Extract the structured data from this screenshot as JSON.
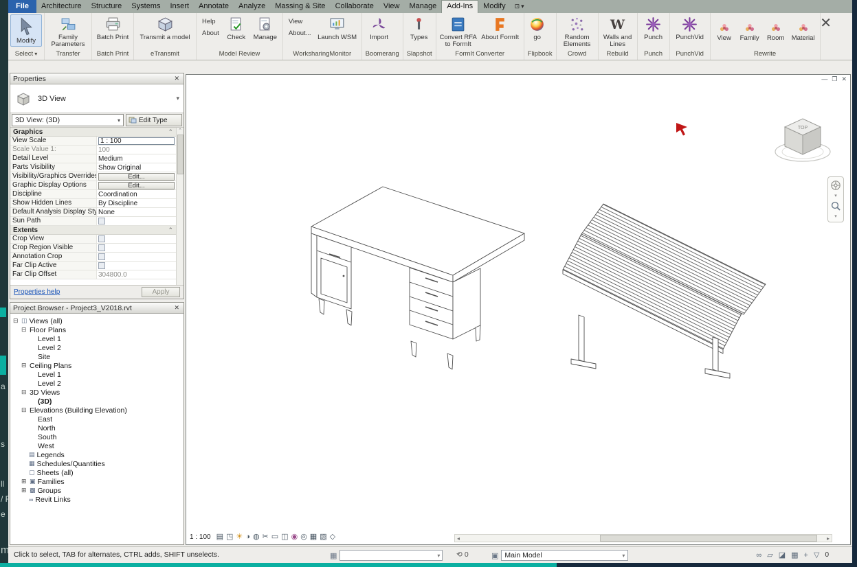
{
  "glyphs": {
    "close": "✕",
    "dropdown": "▾",
    "chevron_up": "⌃",
    "minus_box": "⊟",
    "plus_box": "⊞",
    "minimize": "—",
    "restore": "❐",
    "scroll_left": "◂",
    "scroll_right": "▸",
    "ribbon_toggle": "⊡"
  },
  "ribbon": {
    "file_tab": "File",
    "tabs": [
      "Architecture",
      "Structure",
      "Systems",
      "Insert",
      "Annotate",
      "Analyze",
      "Massing & Site",
      "Collaborate",
      "View",
      "Manage",
      "Add-Ins",
      "Modify"
    ],
    "active_tab": "Add-Ins",
    "panels": [
      {
        "label": "Select",
        "buttons": [
          {
            "label": "Modify"
          }
        ]
      },
      {
        "label": "Transfer",
        "buttons": [
          {
            "label": "Family Parameters"
          }
        ]
      },
      {
        "label": "Batch Print",
        "buttons": [
          {
            "label": "Batch Print"
          }
        ]
      },
      {
        "label": "eTransmit",
        "buttons": [
          {
            "label": "Transmit a model"
          }
        ]
      },
      {
        "label": "Model Review",
        "small": [
          "Help",
          "About"
        ],
        "buttons": [
          {
            "label": "Check"
          },
          {
            "label": "Manage"
          }
        ]
      },
      {
        "label": "WorksharingMonitor",
        "small": [
          "View",
          "About..."
        ],
        "buttons": [
          {
            "label": "Launch WSM"
          }
        ]
      },
      {
        "label": "Boomerang",
        "buttons": [
          {
            "label": "Import"
          }
        ]
      },
      {
        "label": "Slapshot",
        "buttons": [
          {
            "label": "Types"
          }
        ]
      },
      {
        "label": "FormIt Converter",
        "buttons": [
          {
            "label": "Convert RFA to FormIt"
          },
          {
            "label": "About FormIt"
          }
        ]
      },
      {
        "label": "Flipbook",
        "buttons": [
          {
            "label": "go"
          }
        ]
      },
      {
        "label": "Crowd",
        "buttons": [
          {
            "label": "Random Elements"
          }
        ]
      },
      {
        "label": "Rebuild",
        "buttons": [
          {
            "label": "Walls and Lines"
          }
        ]
      },
      {
        "label": "Punch",
        "buttons": [
          {
            "label": "Punch"
          }
        ]
      },
      {
        "label": "PunchVid",
        "buttons": [
          {
            "label": "PunchVid"
          }
        ]
      },
      {
        "label": "Rewrite",
        "buttons": [
          {
            "label": "View"
          },
          {
            "label": "Family"
          },
          {
            "label": "Room"
          },
          {
            "label": "Material"
          }
        ]
      }
    ]
  },
  "properties": {
    "title": "Properties",
    "type_label": "3D View",
    "selector": "3D View: (3D)",
    "edit_type": "Edit Type",
    "rows": [
      {
        "label": "Graphics",
        "value": ""
      },
      {
        "label": "View Scale",
        "value": "1 : 100"
      },
      {
        "label": "Scale Value    1:",
        "value": "100"
      },
      {
        "label": "Detail Level",
        "value": "Medium"
      },
      {
        "label": "Parts Visibility",
        "value": "Show Original"
      },
      {
        "label": "Visibility/Graphics Overrides",
        "value": "Edit..."
      },
      {
        "label": "Graphic Display Options",
        "value": "Edit..."
      },
      {
        "label": "Discipline",
        "value": "Coordination"
      },
      {
        "label": "Show Hidden Lines",
        "value": "By Discipline"
      },
      {
        "label": "Default Analysis Display Style",
        "value": "None"
      },
      {
        "label": "Sun Path",
        "value": ""
      },
      {
        "label": "Extents",
        "value": ""
      },
      {
        "label": "Crop View",
        "value": ""
      },
      {
        "label": "Crop Region Visible",
        "value": ""
      },
      {
        "label": "Annotation Crop",
        "value": ""
      },
      {
        "label": "Far Clip Active",
        "value": ""
      },
      {
        "label": "Far Clip Offset",
        "value": "304800.0"
      }
    ],
    "help_link": "Properties help",
    "apply": "Apply"
  },
  "project_browser": {
    "title": "Project Browser - Project3_V2018.rvt",
    "items": [
      {
        "label": "Views (all)",
        "glyph": "◫"
      },
      {
        "label": "Floor Plans"
      },
      {
        "label": "Level 1"
      },
      {
        "label": "Level 2"
      },
      {
        "label": "Site"
      },
      {
        "label": "Ceiling Plans"
      },
      {
        "label": "Level 1"
      },
      {
        "label": "Level 2"
      },
      {
        "label": "3D Views"
      },
      {
        "label": "(3D)"
      },
      {
        "label": "Elevations (Building Elevation)"
      },
      {
        "label": "East"
      },
      {
        "label": "North"
      },
      {
        "label": "South"
      },
      {
        "label": "West"
      },
      {
        "label": "Legends",
        "glyph": "▤"
      },
      {
        "label": "Schedules/Quantities",
        "glyph": "▦"
      },
      {
        "label": "Sheets (all)",
        "glyph": "▢"
      },
      {
        "label": "Families",
        "glyph": "▣"
      },
      {
        "label": "Groups",
        "glyph": "▩"
      },
      {
        "label": "Revit Links",
        "glyph": "∞"
      }
    ]
  },
  "canvas": {
    "scale": "1 : 100",
    "viewcube_top": "TOP",
    "view_bar_icons": [
      {
        "name": "detail-level-icon",
        "glyph": "▤"
      },
      {
        "name": "visual-style-icon",
        "glyph": "◳"
      },
      {
        "name": "sun-path-icon",
        "glyph": "☀"
      },
      {
        "name": "shadows-icon",
        "glyph": "◑"
      },
      {
        "name": "rendering-icon",
        "glyph": "◍"
      },
      {
        "name": "crop-view-icon",
        "glyph": "✂"
      },
      {
        "name": "crop-region-icon",
        "glyph": "▭"
      },
      {
        "name": "temporary-hide-icon",
        "glyph": "◫"
      },
      {
        "name": "reveal-hidden-icon",
        "glyph": "◉"
      },
      {
        "name": "temporary-view-properties-icon",
        "glyph": "◎"
      },
      {
        "name": "constraints-icon",
        "glyph": "▦"
      },
      {
        "name": "worksharing-display-icon",
        "glyph": "▧"
      },
      {
        "name": "highlight-displaced-icon",
        "glyph": "◇"
      }
    ]
  },
  "status_bar": {
    "message": "Click to select, TAB for alternates, CTRL adds, SHIFT unselects.",
    "workset_glyph": "▦",
    "requests_glyph": "⟲",
    "requests_count": "0",
    "design_glyph": "▣",
    "design_option": "Main Model",
    "right_icons": [
      {
        "name": "select-links-icon",
        "glyph": "∞"
      },
      {
        "name": "select-underlay-icon",
        "glyph": "▱"
      },
      {
        "name": "select-pinned-icon",
        "glyph": "◪"
      },
      {
        "name": "select-by-face-icon",
        "glyph": "▦"
      },
      {
        "name": "drag-on-selection-icon",
        "glyph": "+"
      }
    ],
    "filter_glyph": "▽",
    "filter_count": "0"
  },
  "background": {
    "fragments": [
      "a",
      "s",
      "ll",
      "/ F",
      "e",
      "m"
    ]
  }
}
